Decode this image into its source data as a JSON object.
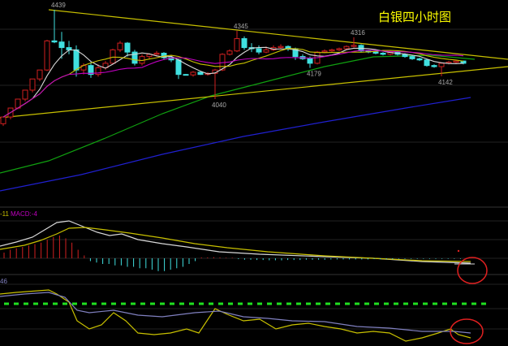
{
  "title": "白银四小时图",
  "colors": {
    "up": "#d02020",
    "down": "#40e0e0",
    "ma5": "#d8d8d8",
    "ma10": "#c8c000",
    "ma20": "#c000c0",
    "ma60": "#10a010",
    "ma120": "#2020d0",
    "trend": "#c8c000",
    "dif": "#d8d8d8",
    "dea": "#c8c000",
    "circle": "#e02020"
  },
  "chart_data": {
    "type": "candlestick",
    "title": "白银四小时图",
    "ylim": [
      3900,
      4460
    ],
    "annotations": [
      {
        "text": "4439",
        "value": 4439,
        "candle": 7
      },
      {
        "text": "4345",
        "value": 4345,
        "candle": 32
      },
      {
        "text": "4040",
        "value": 4040,
        "candle": 29
      },
      {
        "text": "4316",
        "value": 4316,
        "candle": 48
      },
      {
        "text": "4179",
        "value": 4179,
        "candle": 42
      },
      {
        "text": "4142",
        "value": 4142,
        "candle": 60
      }
    ],
    "ohlc": [
      [
        3930,
        3945,
        3920,
        3960
      ],
      [
        3960,
        3975,
        3950,
        4000
      ],
      [
        4000,
        4020,
        3995,
        4040
      ],
      [
        4040,
        4060,
        4030,
        4080
      ],
      [
        4080,
        4100,
        4070,
        4130
      ],
      [
        4130,
        4170,
        4120,
        4170
      ],
      [
        4170,
        4305,
        4165,
        4300
      ],
      [
        4300,
        4439,
        4290,
        4295
      ],
      [
        4295,
        4340,
        4220,
        4270
      ],
      [
        4270,
        4300,
        4240,
        4260
      ],
      [
        4260,
        4280,
        4140,
        4170
      ],
      [
        4170,
        4200,
        4150,
        4190
      ],
      [
        4190,
        4205,
        4135,
        4150
      ],
      [
        4150,
        4195,
        4140,
        4180
      ],
      [
        4180,
        4210,
        4170,
        4200
      ],
      [
        4200,
        4265,
        4195,
        4260
      ],
      [
        4260,
        4300,
        4250,
        4290
      ],
      [
        4290,
        4295,
        4230,
        4250
      ],
      [
        4250,
        4260,
        4190,
        4200
      ],
      [
        4200,
        4240,
        4190,
        4230
      ],
      [
        4230,
        4245,
        4220,
        4240
      ],
      [
        4240,
        4255,
        4230,
        4245
      ],
      [
        4245,
        4250,
        4215,
        4225
      ],
      [
        4225,
        4235,
        4205,
        4215
      ],
      [
        4215,
        4220,
        4130,
        4150
      ],
      [
        4150,
        4152,
        4145,
        4148
      ],
      [
        4148,
        4165,
        4140,
        4160
      ],
      [
        4160,
        4162,
        4148,
        4150
      ],
      [
        4150,
        4160,
        4145,
        4155
      ],
      [
        4155,
        4175,
        4040,
        4170
      ],
      [
        4170,
        4245,
        4165,
        4240
      ],
      [
        4240,
        4262,
        4235,
        4255
      ],
      [
        4255,
        4345,
        4250,
        4310
      ],
      [
        4310,
        4320,
        4260,
        4270
      ],
      [
        4270,
        4290,
        4250,
        4265
      ],
      [
        4265,
        4280,
        4240,
        4250
      ],
      [
        4250,
        4275,
        4245,
        4260
      ],
      [
        4260,
        4280,
        4255,
        4270
      ],
      [
        4270,
        4285,
        4265,
        4275
      ],
      [
        4275,
        4280,
        4255,
        4265
      ],
      [
        4265,
        4270,
        4215,
        4230
      ],
      [
        4230,
        4240,
        4215,
        4220
      ],
      [
        4220,
        4230,
        4179,
        4200
      ],
      [
        4200,
        4255,
        4195,
        4250
      ],
      [
        4250,
        4262,
        4245,
        4255
      ],
      [
        4255,
        4265,
        4250,
        4260
      ],
      [
        4260,
        4270,
        4255,
        4265
      ],
      [
        4265,
        4280,
        4260,
        4275
      ],
      [
        4275,
        4316,
        4270,
        4280
      ],
      [
        4280,
        4285,
        4250,
        4255
      ],
      [
        4255,
        4260,
        4245,
        4250
      ],
      [
        4250,
        4255,
        4240,
        4245
      ],
      [
        4245,
        4250,
        4235,
        4240
      ],
      [
        4240,
        4255,
        4235,
        4250
      ],
      [
        4250,
        4255,
        4235,
        4240
      ],
      [
        4240,
        4245,
        4225,
        4230
      ],
      [
        4230,
        4235,
        4215,
        4220
      ],
      [
        4220,
        4225,
        4210,
        4215
      ],
      [
        4215,
        4218,
        4185,
        4190
      ],
      [
        4190,
        4195,
        4180,
        4185
      ],
      [
        4185,
        4205,
        4142,
        4200
      ],
      [
        4200,
        4210,
        4195,
        4205
      ],
      [
        4205,
        4215,
        4200,
        4210
      ],
      [
        4210,
        4212,
        4195,
        4200
      ]
    ]
  },
  "macd": {
    "label_left": "-11",
    "label": "MACD:-4",
    "hist": [
      2,
      3,
      3.5,
      4,
      4.5,
      5,
      5.5,
      6.5,
      7.5,
      8,
      7,
      5.5,
      3,
      1,
      -1,
      -1.5,
      -2,
      -2,
      -2.5,
      -2.5,
      -3,
      -3,
      -3.5,
      -3.5,
      -4,
      -4.5,
      -4.5,
      -4,
      -3.5,
      -3,
      -2,
      -1,
      0.3,
      0.3,
      0.4,
      0.3,
      0.2,
      0.2,
      -0.3,
      -0.5,
      -0.5,
      -0.6,
      -0.6,
      -0.7,
      -0.7,
      -0.7,
      -0.6,
      -0.6,
      -0.6,
      -0.5,
      -0.5,
      -0.5,
      -0.5,
      -0.4,
      -0.4,
      -0.4,
      -0.4,
      -0.4,
      -0.4,
      -0.4,
      -0.3,
      -0.3,
      -0.3,
      -0.3,
      -0.2,
      -0.2,
      -0.2,
      -0.2,
      -0.2,
      -0.2,
      -0.2,
      -0.2,
      -0.2,
      -0.2,
      -0.2,
      -0.2
    ]
  },
  "lower": {
    "label": "46"
  }
}
